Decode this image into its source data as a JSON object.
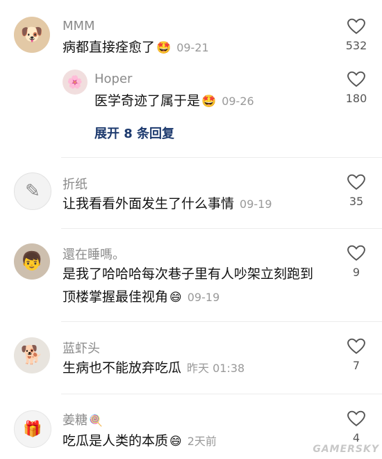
{
  "comments": [
    {
      "user": "MMM",
      "text": "病都直接痊愈了",
      "emoji": "🤩",
      "date": "09-21",
      "likes": "532",
      "reply": {
        "user": "Hoper",
        "text": "医学奇迹了属于是",
        "emoji": "🤩",
        "date": "09-26",
        "likes": "180"
      },
      "expand_label": "展开 8 条回复"
    },
    {
      "user": "折纸",
      "text": "让我看看外面发生了什么事情",
      "date": "09-19",
      "likes": "35"
    },
    {
      "user": "還在睡嗎。",
      "text_line1": "是我了哈哈哈每次巷子里有人吵架立刻跑到",
      "text_line2": "顶楼掌握最佳视角",
      "emoji": "😄",
      "date": "09-19",
      "likes": "9"
    },
    {
      "user": "蓝虾头",
      "text": "生病也不能放弃吃瓜",
      "date": "昨天 01:38",
      "likes": "7"
    },
    {
      "user": "姜糖",
      "user_emoji": "🍭",
      "text": "吃瓜是人类的本质",
      "emoji": "😄",
      "date": "2天前",
      "likes": "4"
    }
  ],
  "watermark": "GAMERSKY"
}
